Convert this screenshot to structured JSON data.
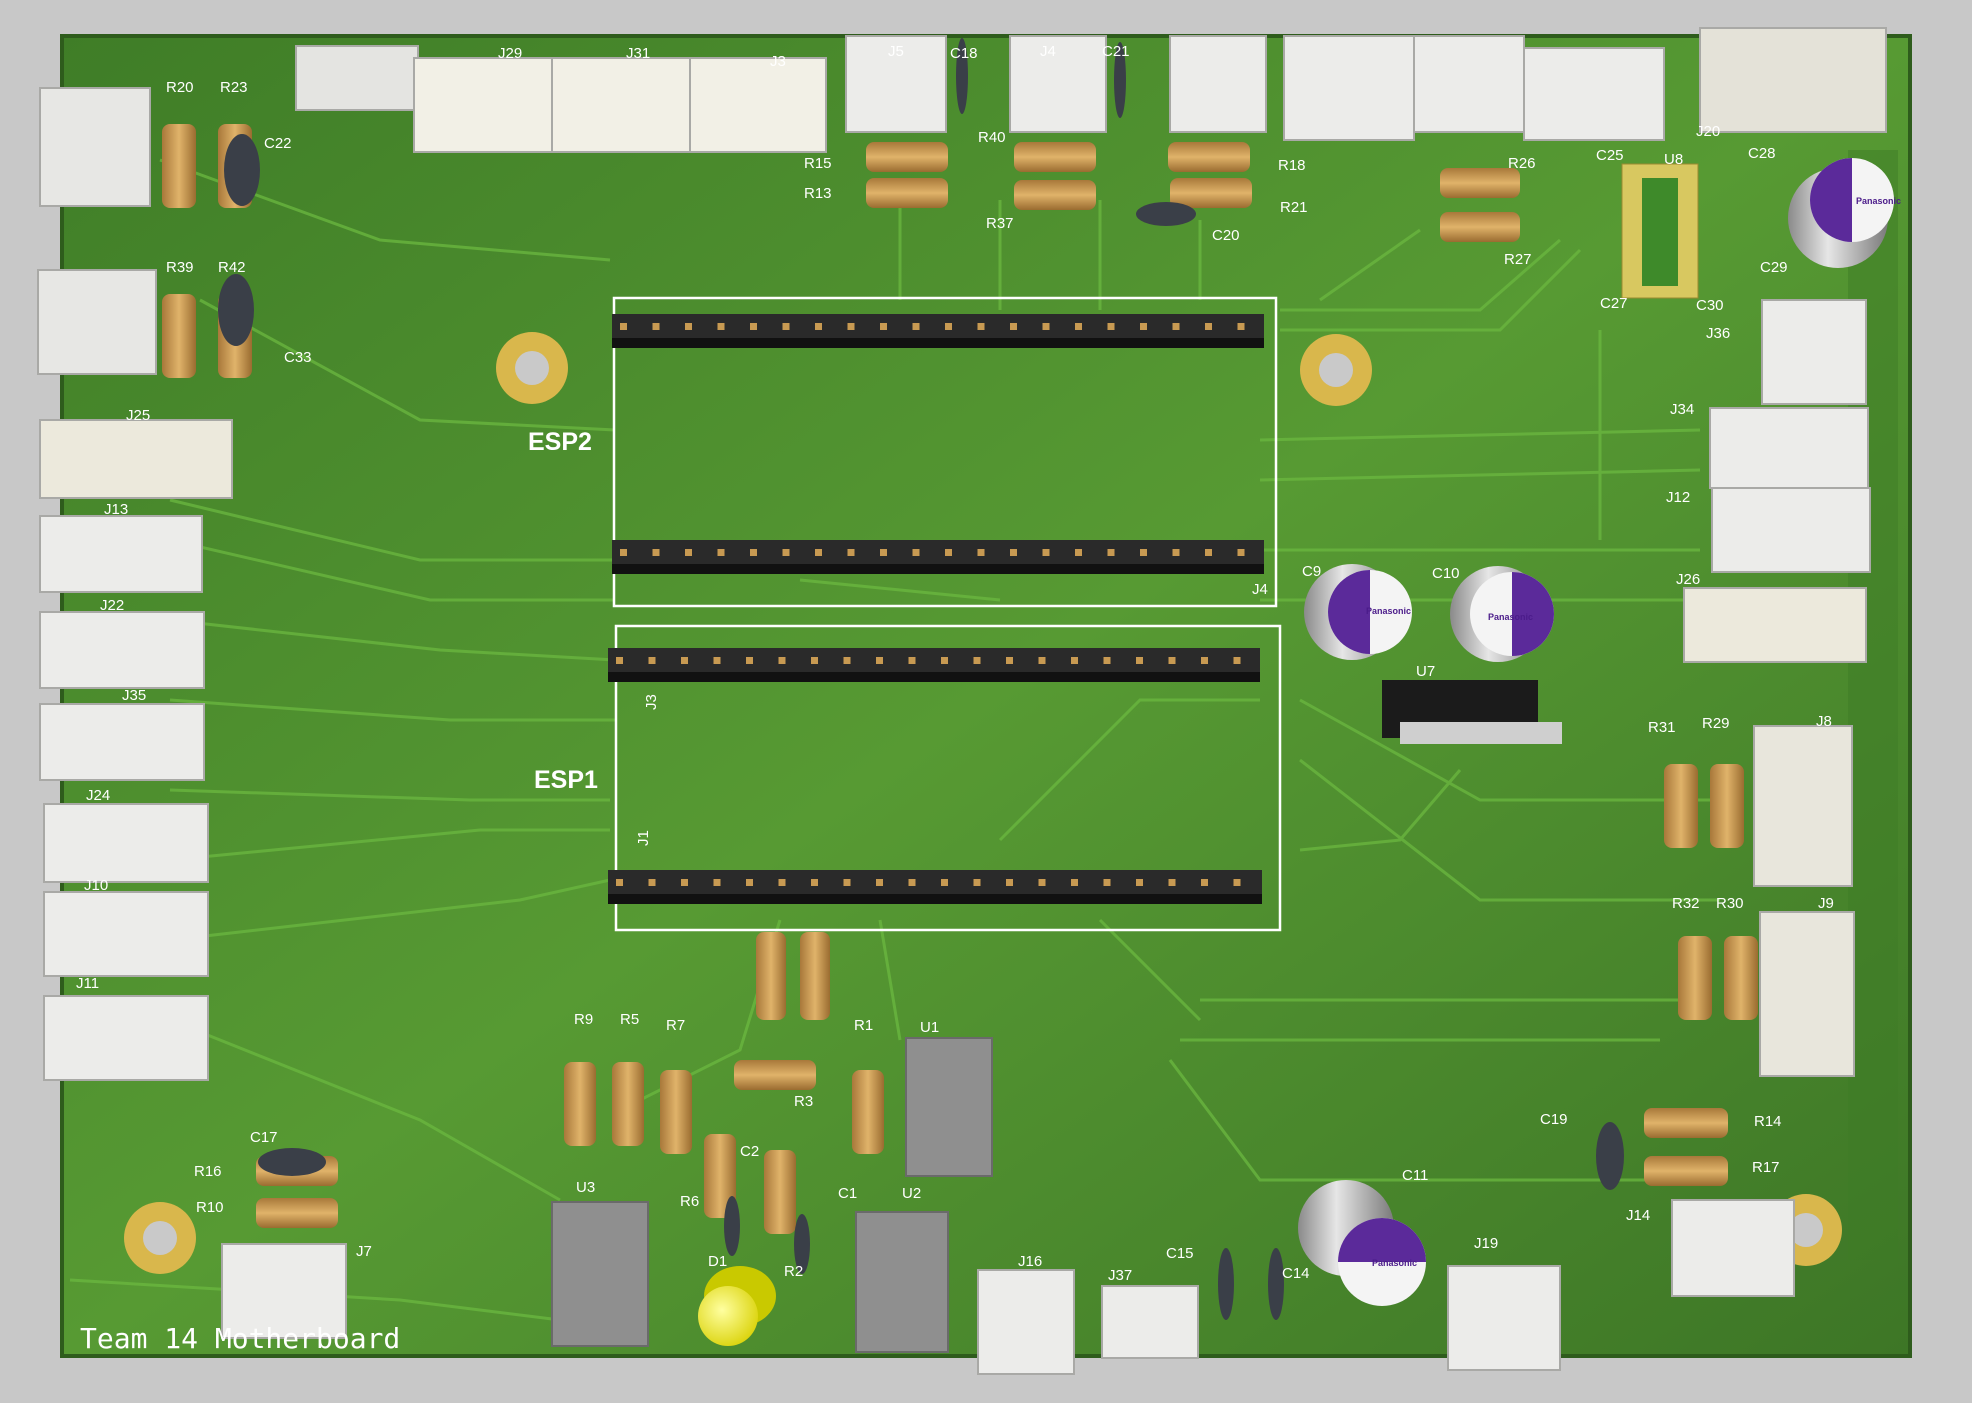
{
  "board": {
    "title": "Team 14 Motherboard",
    "brand": "Panasonic",
    "colors": {
      "background": "#c8c8c8",
      "pcb": "#4f8f2f",
      "pcb_dark": "#3f7a26",
      "trace": "#5fa83a",
      "pad_gold": "#d6b44a",
      "connector": "#e9e9e6",
      "resistor": "#c8964a",
      "header": "#2b2b2b",
      "capacitor_cap": "#5b2a9a"
    }
  },
  "modules": [
    "ESP2",
    "ESP1"
  ],
  "refs": {
    "J29": "J29",
    "J31": "J31",
    "J3x": "J3",
    "J5": "J5",
    "J4x": "J4",
    "J20": "J20",
    "J36": "J36",
    "J34": "J34",
    "J12": "J12",
    "J26": "J26",
    "J8": "J8",
    "J9": "J9",
    "J14": "J14",
    "J19": "J19",
    "J37": "J37",
    "J16": "J16",
    "J7": "J7",
    "J25": "J25",
    "J13": "J13",
    "J22": "J22",
    "J35": "J35",
    "J24": "J24",
    "J10": "J10",
    "J11": "J11",
    "J4": "J4",
    "J3": "J3",
    "J1": "J1",
    "J2": "J2",
    "C18": "C18",
    "C21": "C21",
    "C22": "C22",
    "C33": "C33",
    "C25": "C25",
    "C28": "C28",
    "C29": "C29",
    "C27": "C27",
    "C30": "C30",
    "C20": "C20",
    "C9": "C9",
    "C10": "C10",
    "C11": "C11",
    "C19": "C19",
    "C17": "C17",
    "C15": "C15",
    "C14": "C14",
    "C1": "C1",
    "C2": "C2",
    "R20": "R20",
    "R23": "R23",
    "R39": "R39",
    "R42": "R42",
    "R15": "R15",
    "R13": "R13",
    "R40": "R40",
    "R37": "R37",
    "R18": "R18",
    "R21": "R21",
    "R26": "R26",
    "R27": "R27",
    "R31": "R31",
    "R29": "R29",
    "R32": "R32",
    "R30": "R30",
    "R14": "R14",
    "R17": "R17",
    "R16": "R16",
    "R10": "R10",
    "R9": "R9",
    "R5": "R5",
    "R7": "R7",
    "R1": "R1",
    "R3": "R3",
    "R6": "R6",
    "R2": "R2",
    "U8": "U8",
    "U7": "U7",
    "U1": "U1",
    "U2": "U2",
    "U3": "U3",
    "D1": "D1"
  }
}
